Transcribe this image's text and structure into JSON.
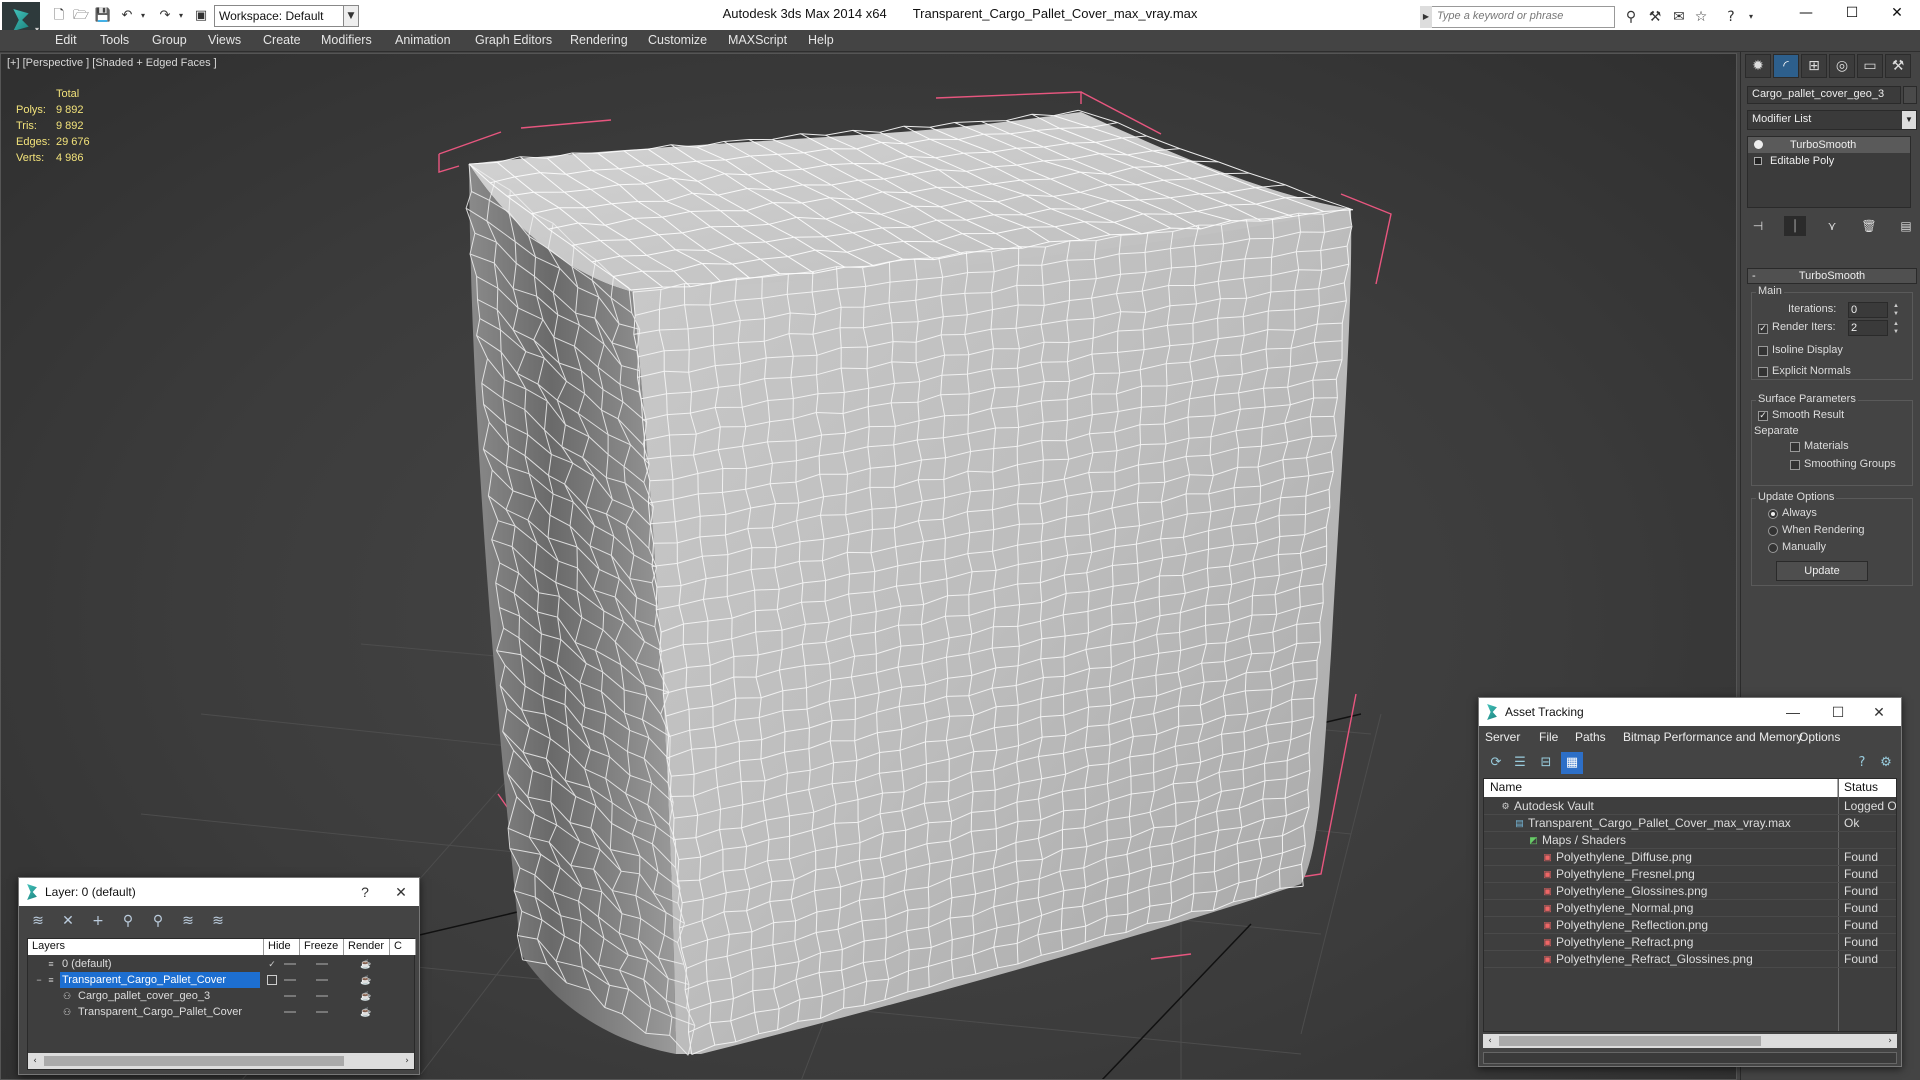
{
  "titlebar": {
    "workspace": "Workspace: Default",
    "app_title": "Autodesk 3ds Max  2014 x64",
    "file_title": "Transparent_Cargo_Pallet_Cover_max_vray.max",
    "search_placeholder": "Type a keyword or phrase"
  },
  "menu": [
    "Edit",
    "Tools",
    "Group",
    "Views",
    "Create",
    "Modifiers",
    "Animation",
    "Graph Editors",
    "Rendering",
    "Customize",
    "MAXScript",
    "Help"
  ],
  "viewport": {
    "label": "[+] [Perspective ] [Shaded + Edged Faces ]",
    "stats": {
      "header": "Total",
      "rows": [
        {
          "key": "Polys:",
          "value": "9 892"
        },
        {
          "key": "Tris:",
          "value": "9 892"
        },
        {
          "key": "Edges:",
          "value": "29 676"
        },
        {
          "key": "Verts:",
          "value": "4 986"
        }
      ]
    }
  },
  "command_panel": {
    "object_name": "Cargo_pallet_cover_geo_3",
    "modifier_list": "Modifier List",
    "stack": [
      "TurboSmooth",
      "Editable Poly"
    ],
    "rollout_title": "TurboSmooth",
    "main_group": "Main",
    "iterations_label": "Iterations:",
    "iterations_value": "0",
    "render_iters_label": "Render Iters:",
    "render_iters_value": "2",
    "isoline_display": "Isoline Display",
    "explicit_normals": "Explicit Normals",
    "surface_params": "Surface Parameters",
    "smooth_result": "Smooth Result",
    "separate": "Separate",
    "materials": "Materials",
    "smoothing_groups": "Smoothing Groups",
    "update_options": "Update Options",
    "always": "Always",
    "when_rendering": "When Rendering",
    "manually": "Manually",
    "update_button": "Update"
  },
  "layer_window": {
    "title": "Layer: 0 (default)",
    "help": "?",
    "columns": [
      "Layers",
      "Hide",
      "Freeze",
      "Render",
      "C"
    ],
    "rows": [
      {
        "name": "0 (default)",
        "level": 0
      },
      {
        "name": "Transparent_Cargo_Pallet_Cover",
        "level": 0
      },
      {
        "name": "Cargo_pallet_cover_geo_3",
        "level": 1
      },
      {
        "name": "Transparent_Cargo_Pallet_Cover",
        "level": 1
      }
    ]
  },
  "asset_window": {
    "title": "Asset Tracking",
    "menu": [
      "Server",
      "File",
      "Paths",
      "Bitmap Performance and Memory",
      "Options"
    ],
    "columns": [
      "Name",
      "Status"
    ],
    "rows": [
      {
        "name": "Autodesk Vault",
        "status": "Logged Out",
        "level": 0
      },
      {
        "name": "Transparent_Cargo_Pallet_Cover_max_vray.max",
        "status": "Ok",
        "level": 1
      },
      {
        "name": "Maps / Shaders",
        "status": "",
        "level": 2
      },
      {
        "name": "Polyethylene_Diffuse.png",
        "status": "Found",
        "level": 3
      },
      {
        "name": "Polyethylene_Fresnel.png",
        "status": "Found",
        "level": 3
      },
      {
        "name": "Polyethylene_Glossines.png",
        "status": "Found",
        "level": 3
      },
      {
        "name": "Polyethylene_Normal.png",
        "status": "Found",
        "level": 3
      },
      {
        "name": "Polyethylene_Reflection.png",
        "status": "Found",
        "level": 3
      },
      {
        "name": "Polyethylene_Refract.png",
        "status": "Found",
        "level": 3
      },
      {
        "name": "Polyethylene_Refract_Glossines.png",
        "status": "Found",
        "level": 3
      }
    ]
  },
  "colors": {
    "accent_blue": "#1d6fd1",
    "stats_yellow": "#f2e27a",
    "bbox_pink": "#e8567f"
  }
}
